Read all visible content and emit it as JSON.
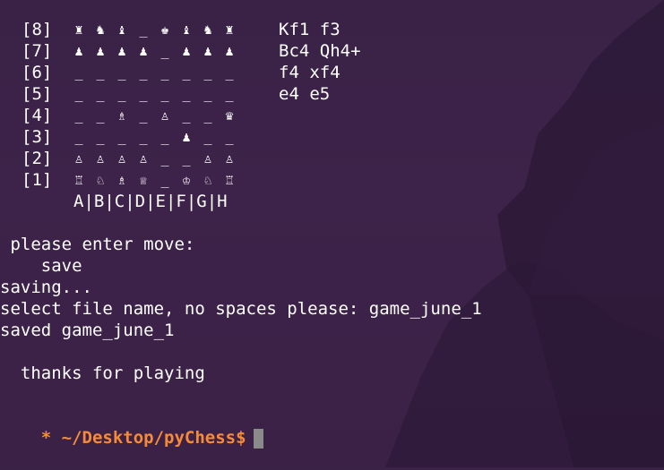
{
  "board": {
    "ranks": [
      {
        "label": "[8]",
        "cells": [
          "♜",
          "♞",
          "♝",
          "_",
          "♚",
          "♝",
          "♞",
          "♜"
        ]
      },
      {
        "label": "[7]",
        "cells": [
          "♟",
          "♟",
          "♟",
          "♟",
          "_",
          "♟",
          "♟",
          "♟"
        ]
      },
      {
        "label": "[6]",
        "cells": [
          "_",
          "_",
          "_",
          "_",
          "_",
          "_",
          "_",
          "_"
        ]
      },
      {
        "label": "[5]",
        "cells": [
          "_",
          "_",
          "_",
          "_",
          "_",
          "_",
          "_",
          "_"
        ]
      },
      {
        "label": "[4]",
        "cells": [
          "_",
          "_",
          "♗",
          "_",
          "♙",
          "_",
          "_",
          "♛"
        ]
      },
      {
        "label": "[3]",
        "cells": [
          "_",
          "_",
          "_",
          "_",
          "_",
          "♟",
          "_",
          "_"
        ]
      },
      {
        "label": "[2]",
        "cells": [
          "♙",
          "♙",
          "♙",
          "♙",
          "_",
          "_",
          "♙",
          "♙"
        ]
      },
      {
        "label": "[1]",
        "cells": [
          "♖",
          "♘",
          "♗",
          "♕",
          "_",
          "♔",
          "♘",
          "♖"
        ]
      }
    ],
    "files": "A|B|C|D|E|F|G|H"
  },
  "move_history": [
    "Kf1 f3",
    "Bc4 Qh4+",
    "f4 xf4",
    "e4 e5"
  ],
  "output_lines": [
    " please enter move:",
    "    save",
    "saving...",
    "select file name, no spaces please: game_june_1",
    "saved game_june_1",
    "",
    "  thanks for playing"
  ],
  "prompt": "* ~/Desktop/pyChess$",
  "colors": {
    "prompt": "#f58b3a",
    "text": "#ffffff",
    "background": "#3c2248",
    "cursor": "#8a8a8a"
  }
}
